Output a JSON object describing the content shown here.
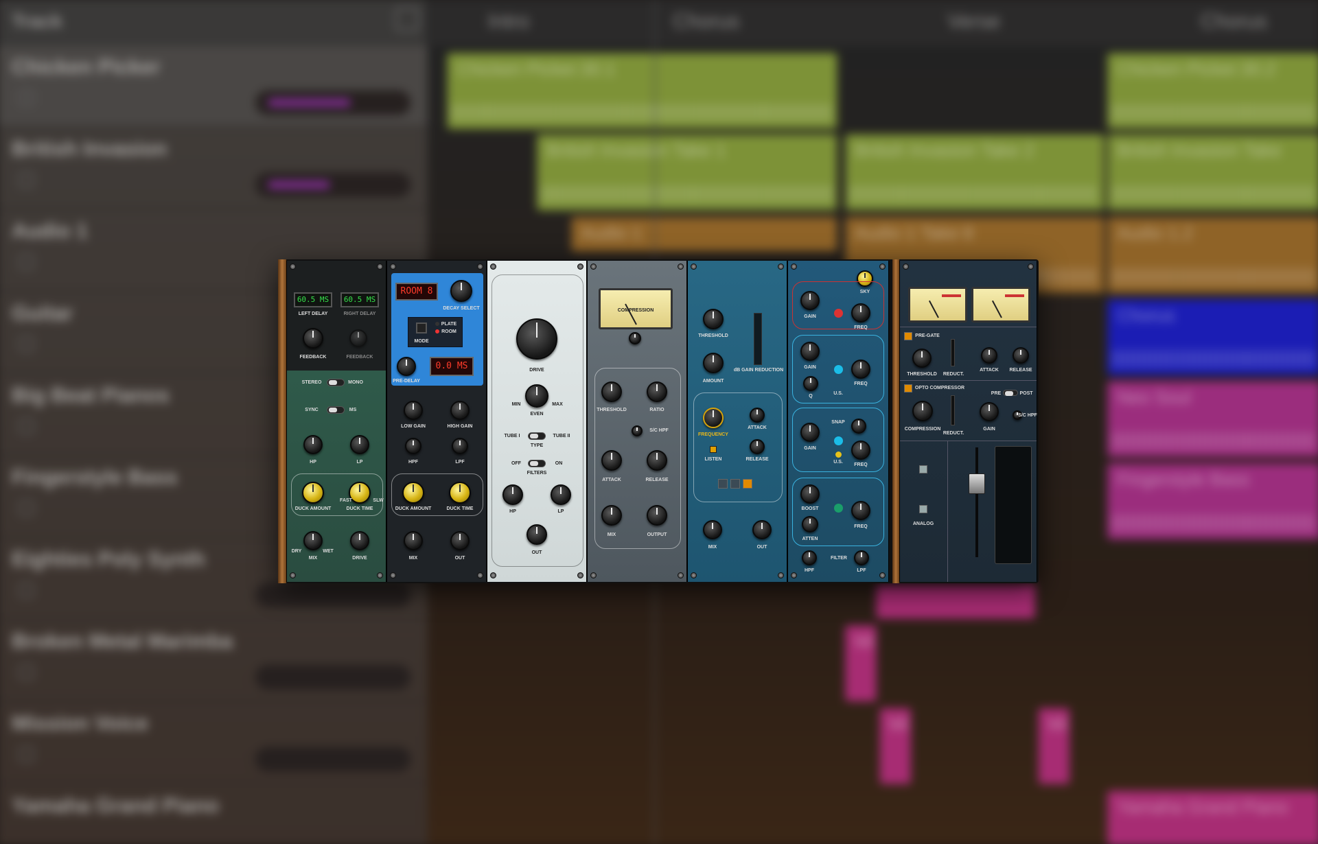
{
  "daw": {
    "header_title": "Track",
    "sections": [
      "Intro",
      "Chorus",
      "Verse",
      "Chorus"
    ],
    "tracks": [
      {
        "name": "Chicken Picker"
      },
      {
        "name": "British Invasion"
      },
      {
        "name": "Audio 1"
      },
      {
        "name": "Guitar"
      },
      {
        "name": "Big Beat Pianos"
      },
      {
        "name": "Fingerstyle Bass"
      },
      {
        "name": "Eighties Poly Synth"
      },
      {
        "name": "Broken Metal Marimba"
      },
      {
        "name": "Mission Voice"
      },
      {
        "name": "Yamaha Grand Piano"
      }
    ],
    "regions": [
      "Chicken Picker.30.1",
      "British Invasion Take 1",
      "British Invasion Take 2",
      "British Invasion Take",
      "Chicken Picker.30.2",
      "Audio 1",
      "Audio 1 Take 8",
      "Audio 1.2",
      "Chorus",
      "Neo Soul",
      "Fingerstyle Bass",
      "Yamaha Grand Piano",
      "Mi",
      "Mi",
      "Mi"
    ]
  },
  "rack": {
    "delay": {
      "left_display": "60.5 MS",
      "right_display": "60.5 MS",
      "left_delay_label": "LEFT DELAY",
      "right_delay_label": "RIGHT DELAY",
      "feedback_label": "FEEDBACK",
      "feedback_label_2": "FEEDBACK",
      "stereo_label": "STEREO",
      "mono_label": "MONO",
      "sync_label": "SYNC",
      "ms_label": "MS",
      "hp_label": "HP",
      "lp_label": "LP",
      "duck_amount_label": "DUCK AMOUNT",
      "duck_time_label": "DUCK TIME",
      "fast_label": "FAST",
      "slow_label": "SLW",
      "mix_label": "MIX",
      "drive_label": "DRIVE",
      "dry_label": "DRY",
      "wet_label": "WET"
    },
    "reverb": {
      "room_display": "ROOM 8",
      "decay_select_label": "DECAY SELECT",
      "mode_label": "MODE",
      "plate_label": "PLATE",
      "room_label": "ROOM",
      "predelay_display": "0.0 MS",
      "predelay_label": "PRE-DELAY",
      "low_gain_label": "LOW GAIN",
      "high_gain_label": "HIGH GAIN",
      "hpf_label": "HPF",
      "lpf_label": "LPF",
      "duck_amount_label": "DUCK AMOUNT",
      "duck_time_label": "DUCK TIME",
      "mix_label": "MIX",
      "out_label": "OUT"
    },
    "saturator": {
      "drive_label": "DRIVE",
      "even_label": "EVEN",
      "min_label": "MIN",
      "max_label": "MAX",
      "tube1_label": "TUBE I",
      "tube2_label": "TUBE II",
      "type_label": "TYPE",
      "off_label": "OFF",
      "on_label": "ON",
      "filters_label": "FILTERS",
      "hp_label": "HP",
      "lp_label": "LP",
      "out_label": "OUT"
    },
    "compressor": {
      "meter_label": "COMPRESSION",
      "threshold_label": "THRESHOLD",
      "ratio_label": "RATIO",
      "attack_label": "ATTACK",
      "release_label": "RELEASE",
      "sc_hpf_label": "S/C HPF",
      "mix_label": "MIX",
      "output_label": "OUTPUT"
    },
    "deesser": {
      "threshold_label": "THRESHOLD",
      "amount_label": "AMOUNT",
      "gain_reduction_label": "dB GAIN REDUCTION",
      "frequency_label": "FREQUENCY",
      "attack_label": "ATTACK",
      "release_label": "RELEASE",
      "listen_label": "LISTEN",
      "mix_label": "MIX",
      "out_label": "OUT"
    },
    "eq": {
      "sky_label": "SKY",
      "gain_label": "GAIN",
      "freq_label": "FREQ",
      "q_label": "Q",
      "us_label": "U.S.",
      "snap_label": "SNAP",
      "boost_label": "BOOST",
      "atten_label": "ATTEN",
      "hpf_label": "HPF",
      "lpf_label": "LPF",
      "filter_label": "FILTER"
    },
    "channel": {
      "pre_gate_label": "PRE-GATE",
      "threshold_label": "THRESHOLD",
      "reduct_label": "REDUCT.",
      "attack_label": "ATTACK",
      "release_label": "RELEASE",
      "opto_label": "OPTO COMPRESSOR",
      "pre_label": "PRE",
      "post_label": "POST",
      "compression_label": "COMPRESSION",
      "gain_label": "GAIN",
      "sc_hpf_label": "S/C HPF",
      "analog_label": "ANALOG"
    }
  },
  "colors": {
    "delay_panel": "#2f5a4a",
    "reverb_panel": "#1f2327",
    "reverb_accent": "#2f86d8",
    "saturator_panel": "#d9e0e0",
    "compressor_panel": "#59636b",
    "deesser_panel": "#1e5570",
    "eq_panel": "#1d4b63",
    "channel_panel": "#1d2a35",
    "wood": "#a06a35"
  }
}
